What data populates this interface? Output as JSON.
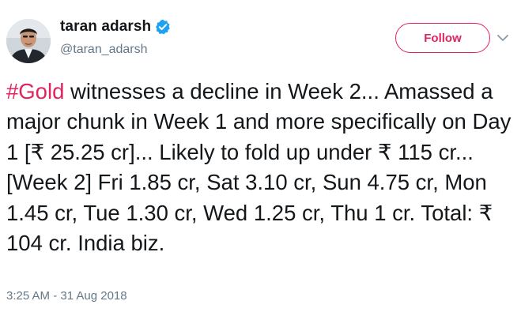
{
  "user": {
    "display_name": "taran adarsh",
    "handle": "@taran_adarsh",
    "verified": true,
    "avatar_icon": "person-photo"
  },
  "follow_button": {
    "label": "Follow",
    "color": "#e0245e"
  },
  "more_icon": "chevron-down-icon",
  "tweet": {
    "hashtag": "#Gold",
    "text": " witnesses a decline in Week 2... Amassed a major chunk in Week 1 and more specifically on Day 1 [₹ 25.25 cr]... Likely to fold up under ₹ 115 cr... [Week 2] Fri 1.85 cr, Sat 3.10 cr, Sun 4.75 cr, Mon 1.45 cr, Tue 1.30 cr, Wed 1.25 cr, Thu 1 cr. Total: ₹ 104 cr. India biz.",
    "timestamp": "3:25 AM - 31 Aug 2018"
  },
  "colors": {
    "accent": "#e0245e",
    "verified_blue": "#1da1f2",
    "text": "#14171a",
    "muted": "#657786"
  }
}
